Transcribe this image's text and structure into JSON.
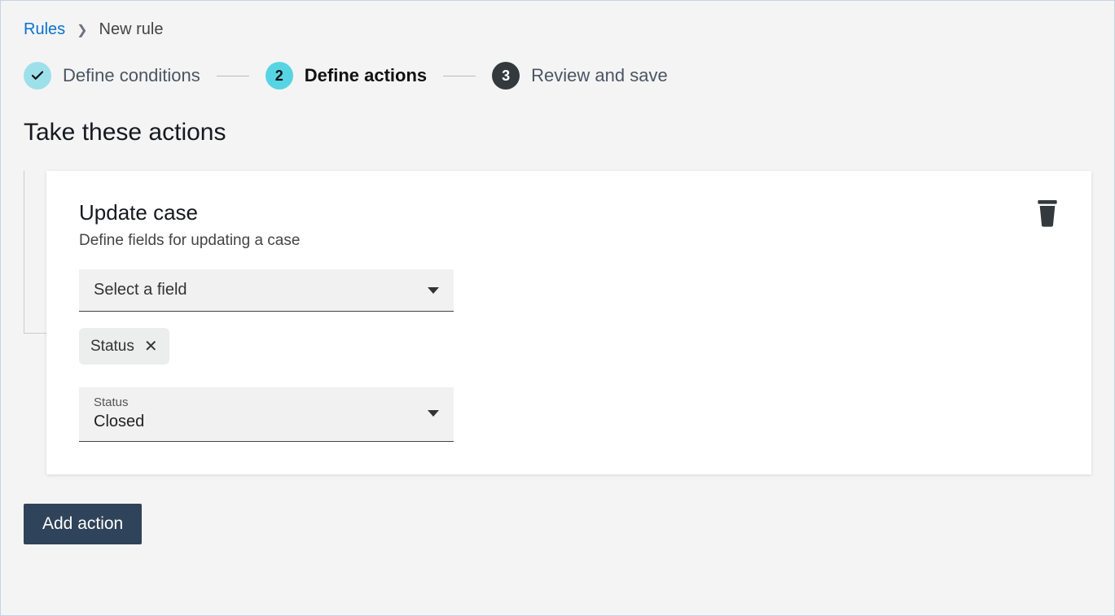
{
  "breadcrumb": {
    "root": "Rules",
    "current": "New rule"
  },
  "stepper": {
    "step1": {
      "label": "Define conditions",
      "state": "done"
    },
    "step2": {
      "number": "2",
      "label": "Define actions",
      "state": "active"
    },
    "step3": {
      "number": "3",
      "label": "Review and save",
      "state": "pending"
    }
  },
  "page_title": "Take these actions",
  "action_card": {
    "title": "Update case",
    "subtitle": "Define fields for updating a case",
    "field_select_placeholder": "Select a field",
    "selected_chip": "Status",
    "status_field": {
      "label": "Status",
      "value": "Closed"
    }
  },
  "buttons": {
    "add_action": "Add action"
  }
}
